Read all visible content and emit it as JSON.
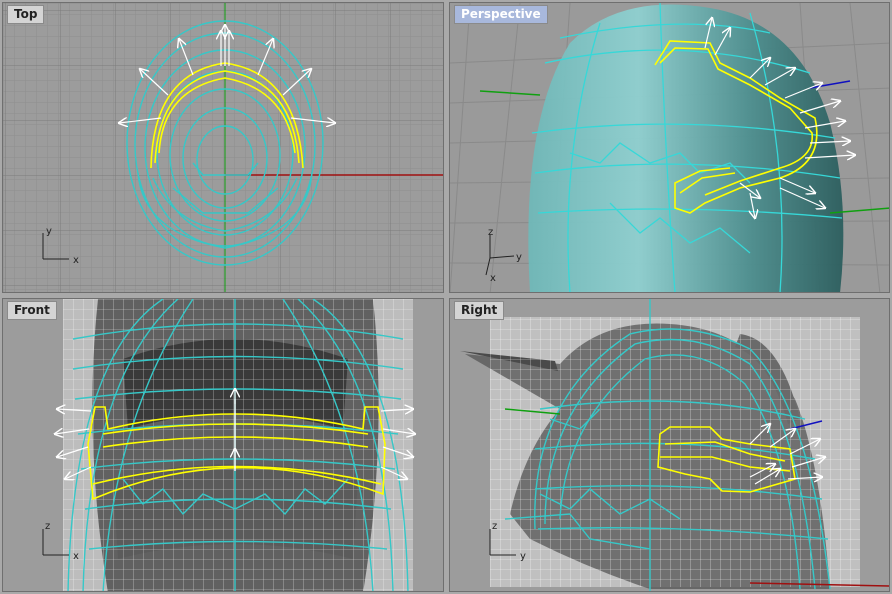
{
  "viewports": {
    "top": {
      "title": "Top",
      "axes": {
        "a": "y",
        "b": "x"
      }
    },
    "persp": {
      "title": "Perspective",
      "axes": {
        "a": "z",
        "b": "y",
        "c": "x"
      }
    },
    "front": {
      "title": "Front",
      "axes": {
        "a": "z",
        "b": "x"
      }
    },
    "right": {
      "title": "Right",
      "axes": {
        "a": "z",
        "b": "y"
      }
    }
  },
  "colors": {
    "grid": "#8e8e8e",
    "grid_major": "#7a7a7a",
    "cyan_curves": "#36c8c8",
    "selected_curve": "#ffff00",
    "normal_arrows": "#ffffff",
    "x_axis": "#a01010",
    "y_axis": "#10a010",
    "z_axis": "#1010c0",
    "title_bg_active": "#a8b8dc"
  }
}
